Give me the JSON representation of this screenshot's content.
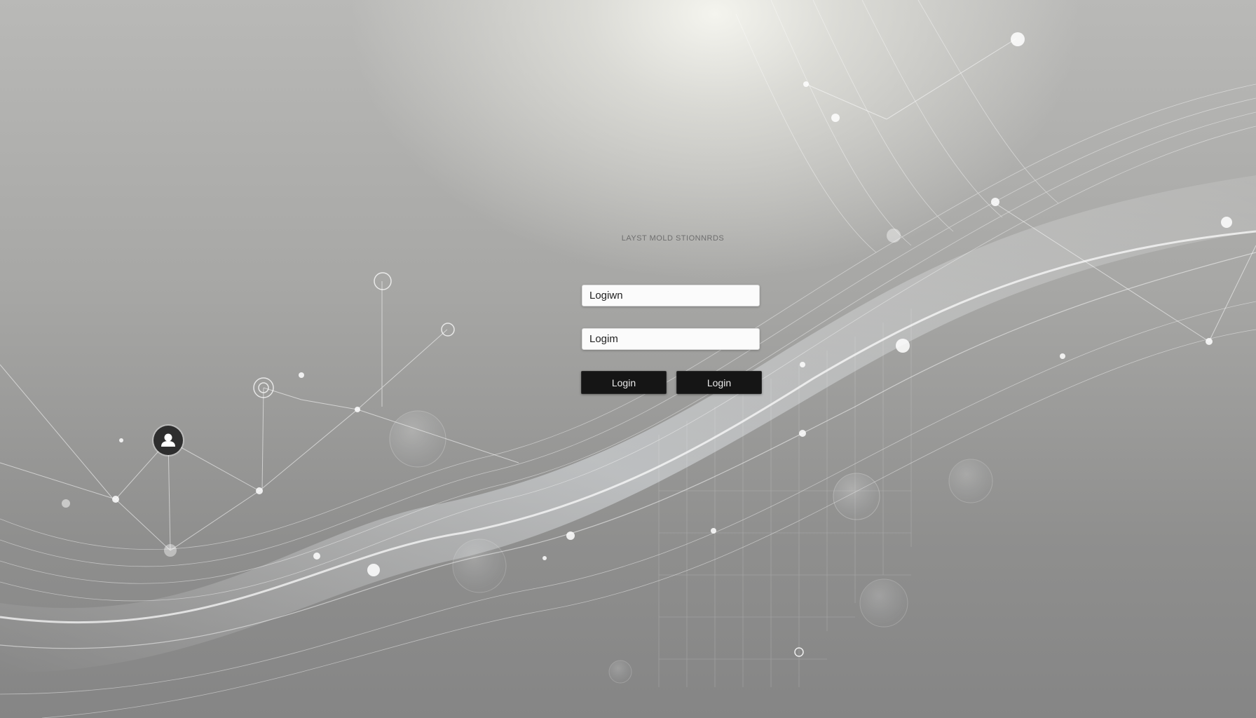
{
  "login": {
    "heading": "LAYST MOLD STIONNRDS",
    "username_field": {
      "value": "Logiwn"
    },
    "password_field": {
      "value": "Logim"
    },
    "primary_button_label": "Login",
    "secondary_button_label": "Login"
  },
  "icons": {
    "network_node": "user-icon"
  },
  "colors": {
    "background": "#a8a8a6",
    "button": "#151515",
    "field": "#fbfbfb"
  }
}
